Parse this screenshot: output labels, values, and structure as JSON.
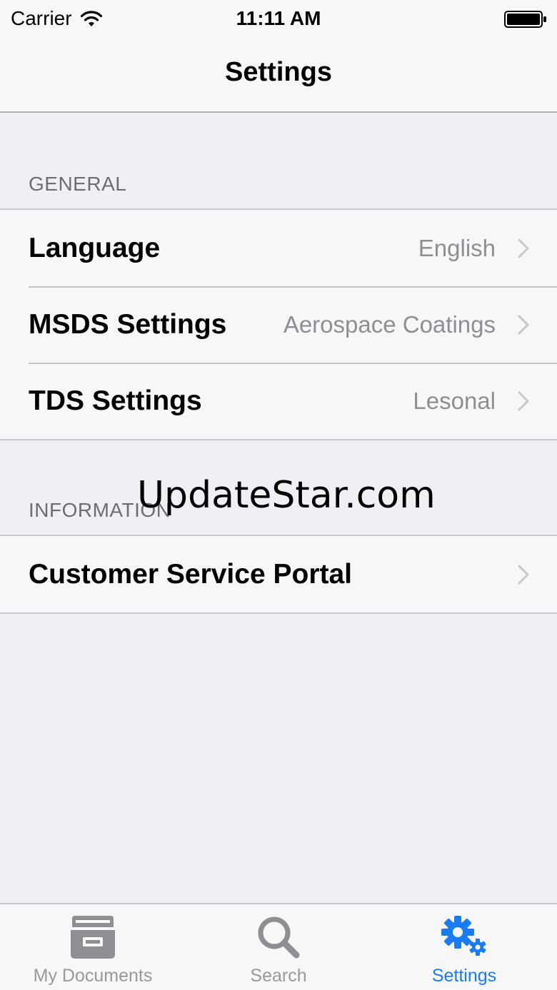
{
  "status_bar": {
    "carrier": "Carrier",
    "time": "11:11 AM",
    "icons": [
      "wifi-icon",
      "battery-icon"
    ]
  },
  "nav": {
    "title": "Settings"
  },
  "sections": {
    "general": {
      "header": "GENERAL",
      "rows": [
        {
          "label": "Language",
          "value": "English",
          "icon": "chevron-right-icon"
        },
        {
          "label": "MSDS Settings",
          "value": "Aerospace Coatings",
          "icon": "chevron-right-icon"
        },
        {
          "label": "TDS Settings",
          "value": "Lesonal",
          "icon": "chevron-right-icon"
        }
      ]
    },
    "information": {
      "header": "INFORMATION",
      "rows": [
        {
          "label": "Customer Service Portal",
          "icon": "chevron-right-icon"
        }
      ]
    }
  },
  "watermark": "UpdateStar.com",
  "tab_bar": {
    "tabs": [
      {
        "label": "My Documents",
        "icon": "archive-box-icon",
        "active": false
      },
      {
        "label": "Search",
        "icon": "search-icon",
        "active": false
      },
      {
        "label": "Settings",
        "icon": "gears-icon",
        "active": true
      }
    ]
  },
  "colors": {
    "accent": "#1a7cf5",
    "background": "#efeff4",
    "inactive_tab": "#999999",
    "secondary_text": "#8e8e93"
  }
}
